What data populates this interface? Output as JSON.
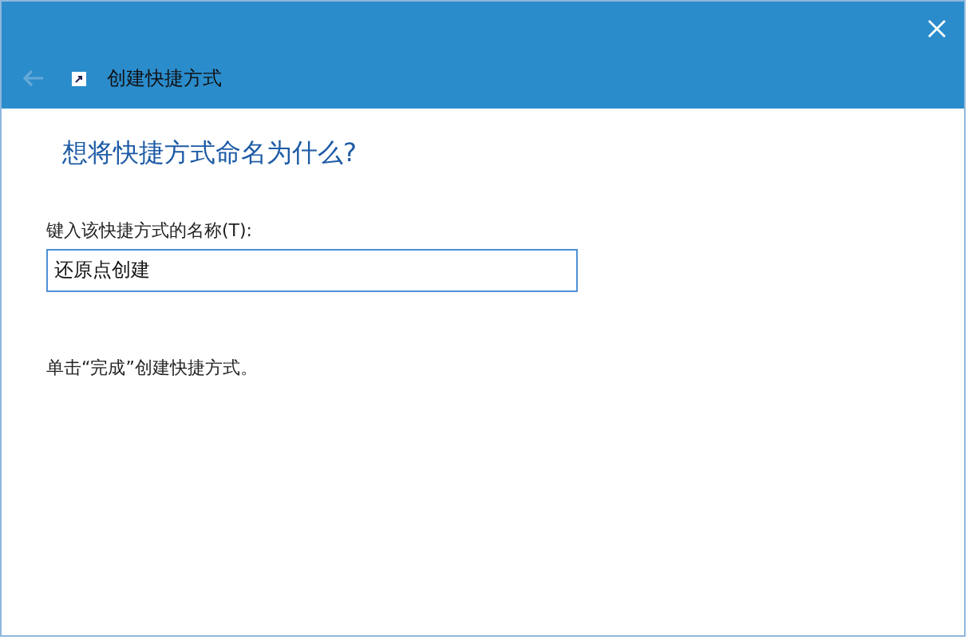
{
  "window": {
    "title": "创建快捷方式",
    "back_disabled": true
  },
  "heading": "想将快捷方式命名为什么?",
  "name_field": {
    "label": "键入该快捷方式的名称(T):",
    "value": "还原点创建"
  },
  "hint": "单击“完成”创建快捷方式。"
}
